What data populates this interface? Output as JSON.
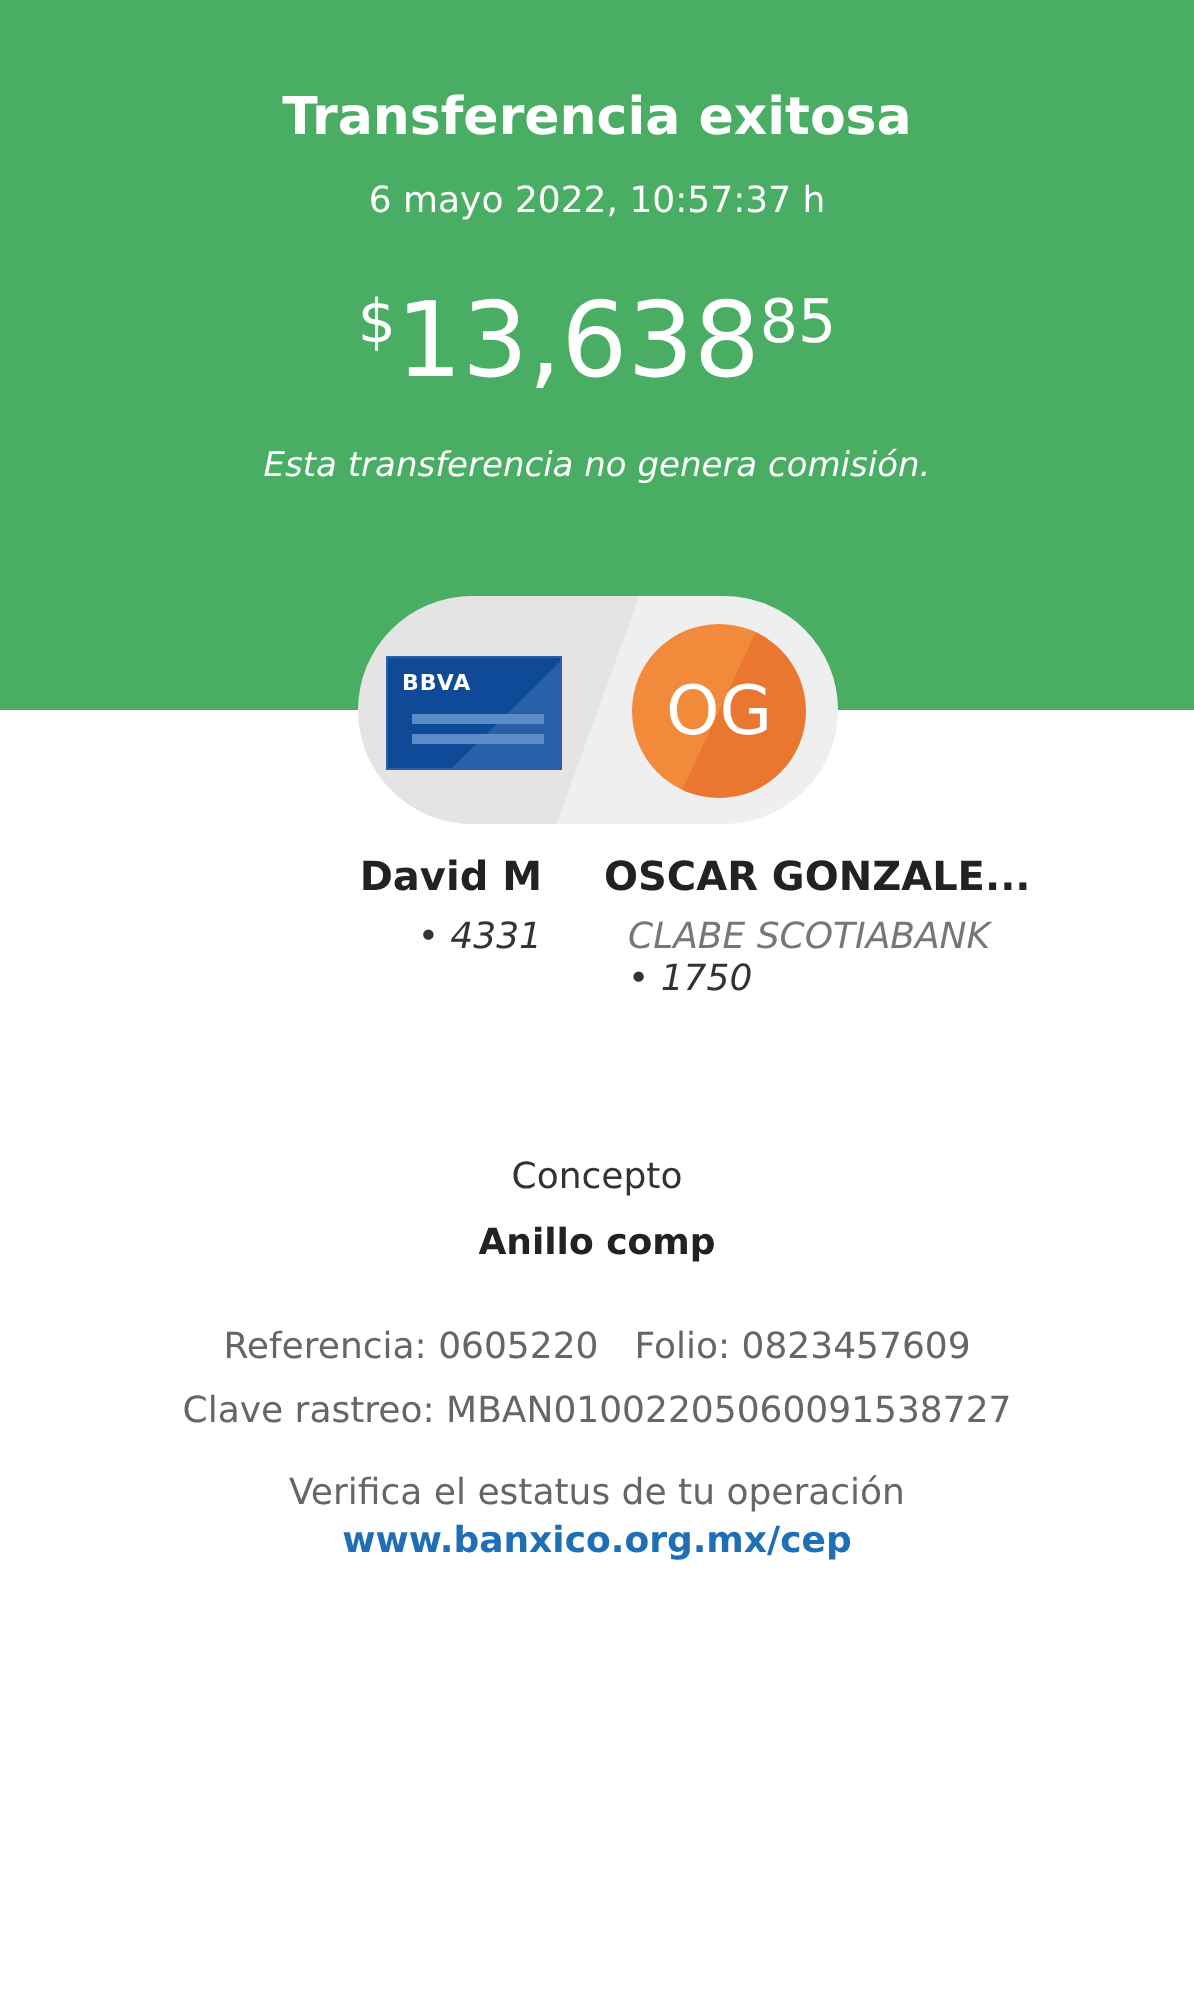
{
  "header": {
    "title": "Transferencia exitosa",
    "datetime": "6 mayo 2022, 10:57:37 h",
    "amount": {
      "currency": "$",
      "whole": "13,638",
      "cents": "85"
    },
    "note": "Esta transferencia no genera comisión."
  },
  "sender": {
    "card_brand": "BBVA",
    "name": "David M",
    "account": "• 4331"
  },
  "recipient": {
    "initials": "OG",
    "name": "OSCAR GONZALE...",
    "bank": "CLABE SCOTIABANK",
    "account": "• 1750"
  },
  "concept": {
    "label": "Concepto",
    "value": "Anillo comp"
  },
  "reference": "Referencia: 0605220",
  "folio": "Folio: 0823457609",
  "tracking": "Clave rastreo: MBAN01002205060091538727",
  "verify": {
    "text": "Verifica el estatus de tu operación",
    "link": "www.banxico.org.mx/cep"
  }
}
